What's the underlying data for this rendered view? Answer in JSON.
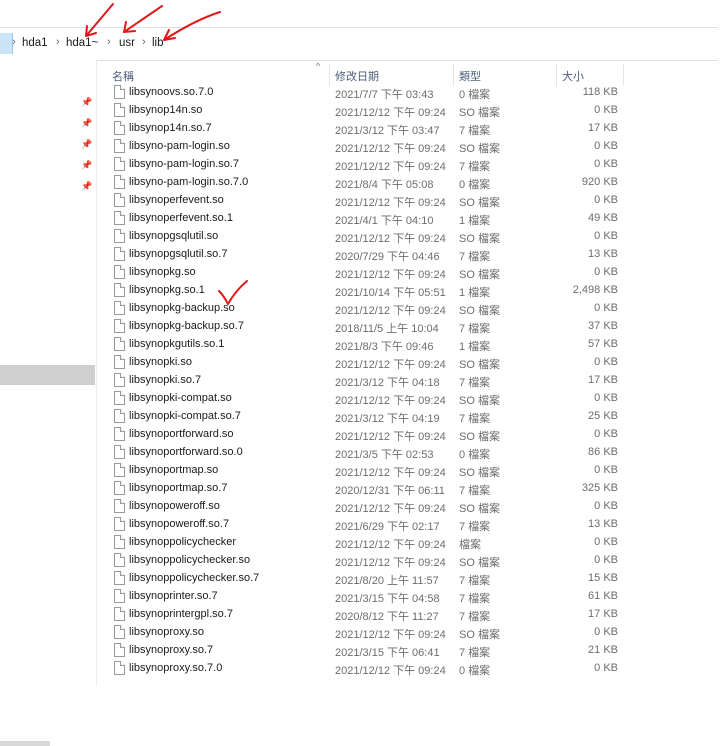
{
  "breadcrumb": {
    "items": [
      "hda1",
      "hda1~",
      "usr",
      "lib"
    ]
  },
  "columns": {
    "name": "名稱",
    "date": "修改日期",
    "type": "類型",
    "size": "大小"
  },
  "files": [
    {
      "name": "libsynoovs.so.7.0",
      "date": "2021/7/7 下午 03:43",
      "type": "0 檔案",
      "size": "118 KB"
    },
    {
      "name": "libsynop14n.so",
      "date": "2021/12/12 下午 09:24",
      "type": "SO 檔案",
      "size": "0 KB"
    },
    {
      "name": "libsynop14n.so.7",
      "date": "2021/3/12 下午 03:47",
      "type": "7 檔案",
      "size": "17 KB"
    },
    {
      "name": "libsyno-pam-login.so",
      "date": "2021/12/12 下午 09:24",
      "type": "SO 檔案",
      "size": "0 KB"
    },
    {
      "name": "libsyno-pam-login.so.7",
      "date": "2021/12/12 下午 09:24",
      "type": "7 檔案",
      "size": "0 KB"
    },
    {
      "name": "libsyno-pam-login.so.7.0",
      "date": "2021/8/4 下午 05:08",
      "type": "0 檔案",
      "size": "920 KB"
    },
    {
      "name": "libsynoperfevent.so",
      "date": "2021/12/12 下午 09:24",
      "type": "SO 檔案",
      "size": "0 KB"
    },
    {
      "name": "libsynoperfevent.so.1",
      "date": "2021/4/1 下午 04:10",
      "type": "1 檔案",
      "size": "49 KB"
    },
    {
      "name": "libsynopgsqlutil.so",
      "date": "2021/12/12 下午 09:24",
      "type": "SO 檔案",
      "size": "0 KB"
    },
    {
      "name": "libsynopgsqlutil.so.7",
      "date": "2020/7/29 下午 04:46",
      "type": "7 檔案",
      "size": "13 KB"
    },
    {
      "name": "libsynopkg.so",
      "date": "2021/12/12 下午 09:24",
      "type": "SO 檔案",
      "size": "0 KB"
    },
    {
      "name": "libsynopkg.so.1",
      "date": "2021/10/14 下午 05:51",
      "type": "1 檔案",
      "size": "2,498 KB"
    },
    {
      "name": "libsynopkg-backup.so",
      "date": "2021/12/12 下午 09:24",
      "type": "SO 檔案",
      "size": "0 KB"
    },
    {
      "name": "libsynopkg-backup.so.7",
      "date": "2018/11/5 上午 10:04",
      "type": "7 檔案",
      "size": "37 KB"
    },
    {
      "name": "libsynopkgutils.so.1",
      "date": "2021/8/3 下午 09:46",
      "type": "1 檔案",
      "size": "57 KB"
    },
    {
      "name": "libsynopki.so",
      "date": "2021/12/12 下午 09:24",
      "type": "SO 檔案",
      "size": "0 KB"
    },
    {
      "name": "libsynopki.so.7",
      "date": "2021/3/12 下午 04:18",
      "type": "7 檔案",
      "size": "17 KB"
    },
    {
      "name": "libsynopki-compat.so",
      "date": "2021/12/12 下午 09:24",
      "type": "SO 檔案",
      "size": "0 KB"
    },
    {
      "name": "libsynopki-compat.so.7",
      "date": "2021/3/12 下午 04:19",
      "type": "7 檔案",
      "size": "25 KB"
    },
    {
      "name": "libsynoportforward.so",
      "date": "2021/12/12 下午 09:24",
      "type": "SO 檔案",
      "size": "0 KB"
    },
    {
      "name": "libsynoportforward.so.0",
      "date": "2021/3/5 下午 02:53",
      "type": "0 檔案",
      "size": "86 KB"
    },
    {
      "name": "libsynoportmap.so",
      "date": "2021/12/12 下午 09:24",
      "type": "SO 檔案",
      "size": "0 KB"
    },
    {
      "name": "libsynoportmap.so.7",
      "date": "2020/12/31 下午 06:11",
      "type": "7 檔案",
      "size": "325 KB"
    },
    {
      "name": "libsynopoweroff.so",
      "date": "2021/12/12 下午 09:24",
      "type": "SO 檔案",
      "size": "0 KB"
    },
    {
      "name": "libsynopoweroff.so.7",
      "date": "2021/6/29 下午 02:17",
      "type": "7 檔案",
      "size": "13 KB"
    },
    {
      "name": "libsynoppolicychecker",
      "date": "2021/12/12 下午 09:24",
      "type": "檔案",
      "size": "0 KB"
    },
    {
      "name": "libsynoppolicychecker.so",
      "date": "2021/12/12 下午 09:24",
      "type": "SO 檔案",
      "size": "0 KB"
    },
    {
      "name": "libsynoppolicychecker.so.7",
      "date": "2021/8/20 上午 11:57",
      "type": "7 檔案",
      "size": "15 KB"
    },
    {
      "name": "libsynoprinter.so.7",
      "date": "2021/3/15 下午 04:58",
      "type": "7 檔案",
      "size": "61 KB"
    },
    {
      "name": "libsynoprintergpl.so.7",
      "date": "2020/8/12 下午 11:27",
      "type": "7 檔案",
      "size": "17 KB"
    },
    {
      "name": "libsynoproxy.so",
      "date": "2021/12/12 下午 09:24",
      "type": "SO 檔案",
      "size": "0 KB"
    },
    {
      "name": "libsynoproxy.so.7",
      "date": "2021/3/15 下午 06:41",
      "type": "7 檔案",
      "size": "21 KB"
    },
    {
      "name": "libsynoproxy.so.7.0",
      "date": "2021/12/12 下午 09:24",
      "type": "0 檔案",
      "size": "0 KB"
    }
  ],
  "colors": {
    "annotation": "#e01818",
    "selection": "#cfcfcf"
  }
}
